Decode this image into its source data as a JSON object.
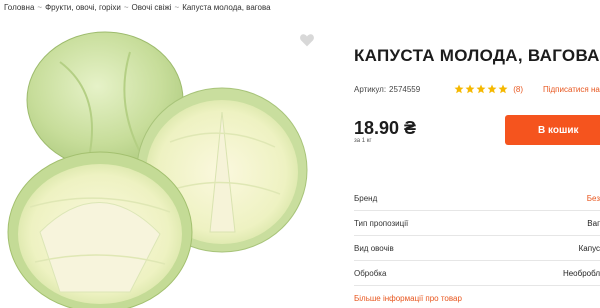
{
  "breadcrumb": {
    "items": [
      "Головна",
      "Фрукти, овочі, горіхи",
      "Овочі свіжі",
      "Капуста молода, вагова"
    ],
    "separator": "~"
  },
  "product": {
    "title": "КАПУСТА МОЛОДА, ВАГОВА",
    "sku_label": "Артикул:",
    "sku": "2574559",
    "rating": 5,
    "rating_count": "(8)",
    "subscribe_label": "Підписатися на достав",
    "price": "18.90 ₴",
    "unit": "за 1 кг",
    "cart_label": "В кошик",
    "favorite_icon": "heart-icon"
  },
  "attributes": [
    {
      "label": "Бренд",
      "value": "Без"
    },
    {
      "label": "Тип пропозиції",
      "value": "Ваг"
    },
    {
      "label": "Вид овочів",
      "value": "Капус"
    },
    {
      "label": "Обробка",
      "value": "Необробл"
    }
  ],
  "more_info_label": "Більше інформації про товар",
  "colors": {
    "accent": "#f5541e",
    "star": "#f5b800",
    "text": "#1c1c1c"
  }
}
